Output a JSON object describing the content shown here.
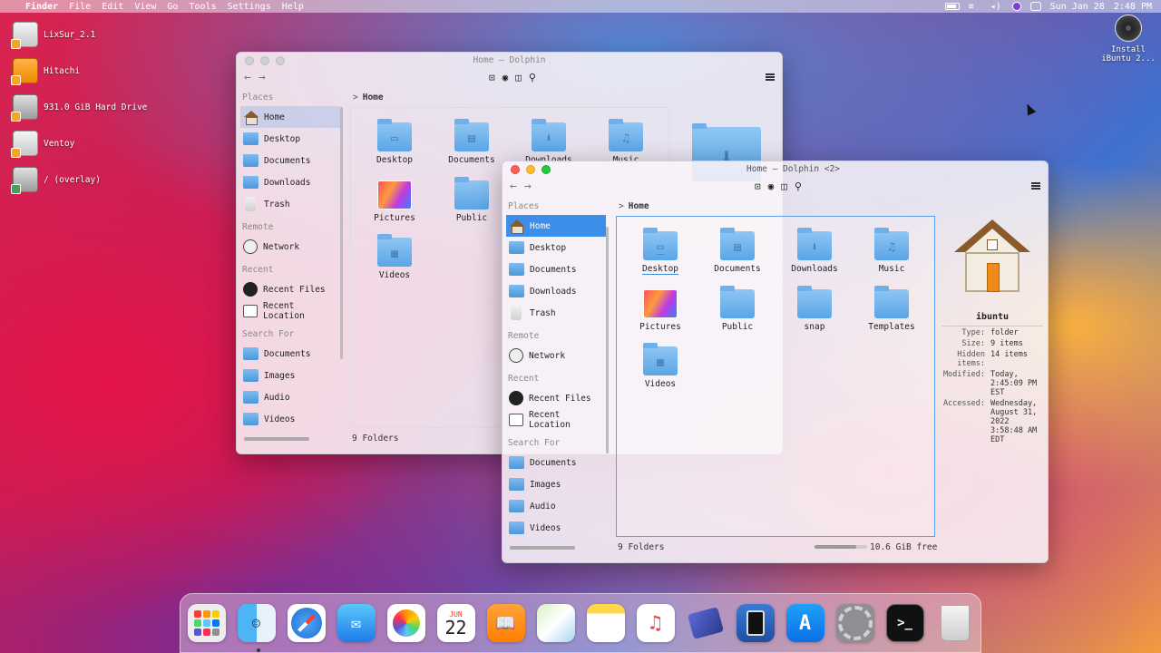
{
  "menubar": {
    "app": "Finder",
    "items": [
      "File",
      "Edit",
      "View",
      "Go",
      "Tools",
      "Settings",
      "Help"
    ],
    "date": "Sun Jan 28",
    "time": "2:48 PM"
  },
  "desktop": {
    "icons": [
      {
        "label": "LixSur_2.1",
        "kind": "drive-gray"
      },
      {
        "label": "Hitachi",
        "kind": "drive-orange"
      },
      {
        "label": "931.0 GiB Hard Drive",
        "kind": "drive-hdd"
      },
      {
        "label": "Ventoy",
        "kind": "drive-gray"
      },
      {
        "label": "/ (overlay)",
        "kind": "drive-hdd"
      }
    ],
    "install_label_1": "Install",
    "install_label_2": "iBuntu 2..."
  },
  "window_back": {
    "title": "Home — Dolphin",
    "breadcrumb": "Home",
    "status_left": "9 Folders",
    "sidebar": {
      "places_head": "Places",
      "places": [
        "Home",
        "Desktop",
        "Documents",
        "Downloads",
        "Trash"
      ],
      "remote_head": "Remote",
      "remote": [
        "Network"
      ],
      "recent_head": "Recent",
      "recent": [
        "Recent Files",
        "Recent Location"
      ],
      "search_head": "Search For",
      "search": [
        "Documents",
        "Images",
        "Audio",
        "Videos"
      ]
    },
    "folders": [
      "Desktop",
      "Documents",
      "Downloads",
      "Music",
      "Pictures",
      "Public",
      "Videos"
    ]
  },
  "window_front": {
    "title": "Home — Dolphin <2>",
    "breadcrumb": "Home",
    "status_left": "9 Folders",
    "status_right": "10.6 GiB free",
    "free_fraction": 0.8,
    "sidebar": {
      "places_head": "Places",
      "places": [
        "Home",
        "Desktop",
        "Documents",
        "Downloads",
        "Trash"
      ],
      "remote_head": "Remote",
      "remote": [
        "Network"
      ],
      "recent_head": "Recent",
      "recent": [
        "Recent Files",
        "Recent Location"
      ],
      "search_head": "Search For",
      "search": [
        "Documents",
        "Images",
        "Audio",
        "Videos"
      ]
    },
    "folders": [
      "Desktop",
      "Documents",
      "Downloads",
      "Music",
      "Pictures",
      "Public",
      "snap",
      "Templates",
      "Videos"
    ],
    "info": {
      "name": "ibuntu",
      "rows": [
        {
          "k": "Type:",
          "v": "folder"
        },
        {
          "k": "Size:",
          "v": "9 items"
        },
        {
          "k": "Hidden items:",
          "v": "14 items"
        },
        {
          "k": "Modified:",
          "v": "Today, 2:45:09 PM EST"
        },
        {
          "k": "Accessed:",
          "v": "Wednesday, August 31, 2022 3:58:48 AM EDT"
        }
      ]
    }
  },
  "dock": {
    "calendar_month": "JUN",
    "calendar_day": "22",
    "apps": [
      "Launchpad",
      "Finder",
      "Safari",
      "Mail",
      "Photos",
      "Calendar",
      "Books",
      "Maps",
      "Notes",
      "Music",
      "Video",
      "iPad",
      "App Store",
      "System Preferences",
      "Terminal",
      "Trash"
    ]
  }
}
